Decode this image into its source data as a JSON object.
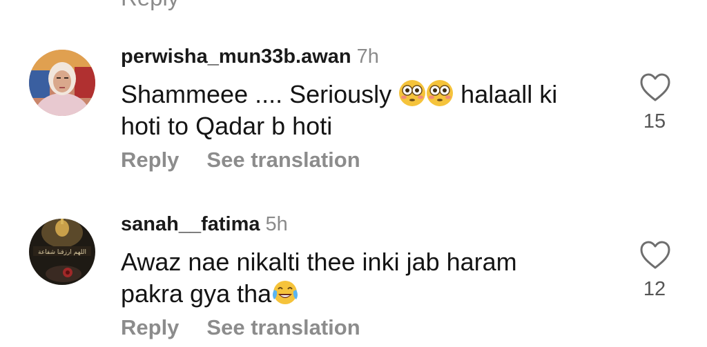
{
  "top_clipped_text": "Reply",
  "comments": [
    {
      "username": "perwisha_mun33b.awan",
      "time": "7h",
      "text_line1a": "Shammeee .... Seriously ",
      "text_line1b": " halaall ki",
      "text_line2": "hoti to Qadar b hoti",
      "emojis": [
        "flushed-face-emoji",
        "flushed-face-emoji"
      ],
      "reply_label": "Reply",
      "translate_label": "See translation",
      "likes": "15"
    },
    {
      "username": "sanah__fatima",
      "time": "5h",
      "text_line1": "Awaz nae  nikalti thee inki jab haram",
      "text_line2": "pakra gya tha",
      "emojis": [
        "tears-of-joy-emoji"
      ],
      "reply_label": "Reply",
      "translate_label": "See translation",
      "likes": "12"
    }
  ]
}
